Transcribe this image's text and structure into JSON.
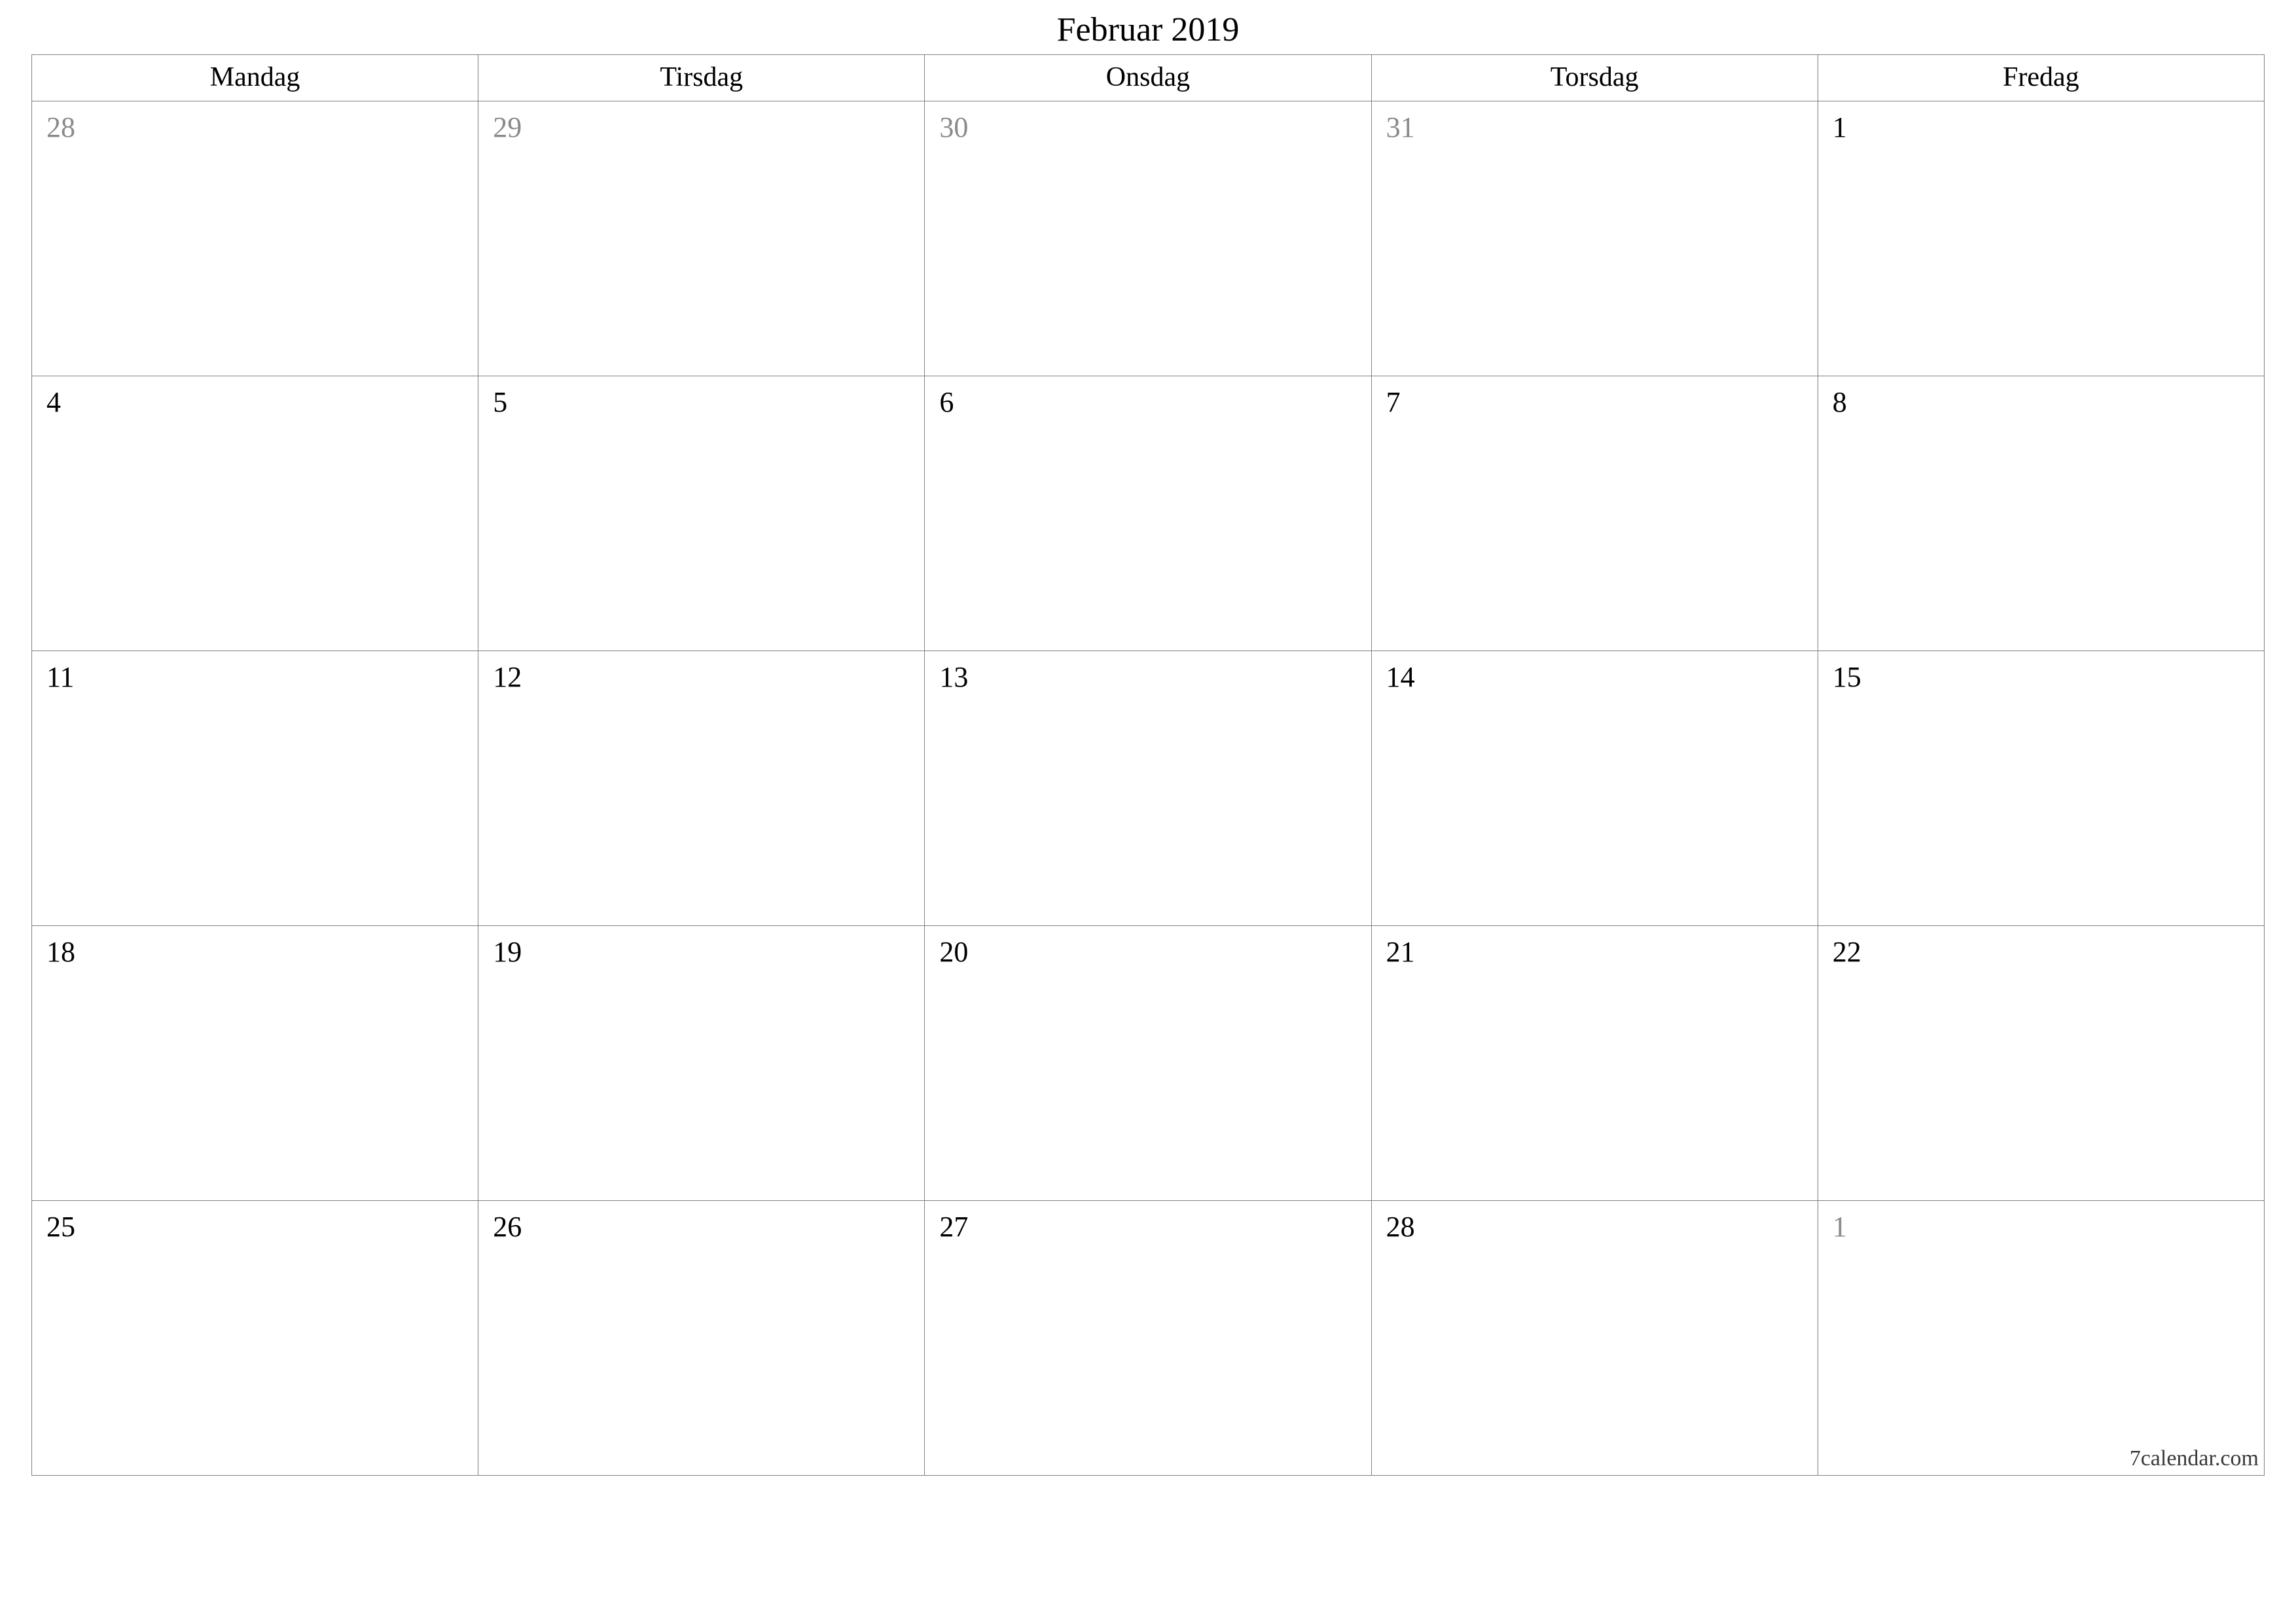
{
  "title": "Februar 2019",
  "weekdays": [
    "Mandag",
    "Tirsdag",
    "Onsdag",
    "Torsdag",
    "Fredag"
  ],
  "weeks": [
    [
      {
        "day": "28",
        "other": true
      },
      {
        "day": "29",
        "other": true
      },
      {
        "day": "30",
        "other": true
      },
      {
        "day": "31",
        "other": true
      },
      {
        "day": "1",
        "other": false
      }
    ],
    [
      {
        "day": "4",
        "other": false
      },
      {
        "day": "5",
        "other": false
      },
      {
        "day": "6",
        "other": false
      },
      {
        "day": "7",
        "other": false
      },
      {
        "day": "8",
        "other": false
      }
    ],
    [
      {
        "day": "11",
        "other": false
      },
      {
        "day": "12",
        "other": false
      },
      {
        "day": "13",
        "other": false
      },
      {
        "day": "14",
        "other": false
      },
      {
        "day": "15",
        "other": false
      }
    ],
    [
      {
        "day": "18",
        "other": false
      },
      {
        "day": "19",
        "other": false
      },
      {
        "day": "20",
        "other": false
      },
      {
        "day": "21",
        "other": false
      },
      {
        "day": "22",
        "other": false
      }
    ],
    [
      {
        "day": "25",
        "other": false
      },
      {
        "day": "26",
        "other": false
      },
      {
        "day": "27",
        "other": false
      },
      {
        "day": "28",
        "other": false
      },
      {
        "day": "1",
        "other": true
      }
    ]
  ],
  "footer": "7calendar.com"
}
